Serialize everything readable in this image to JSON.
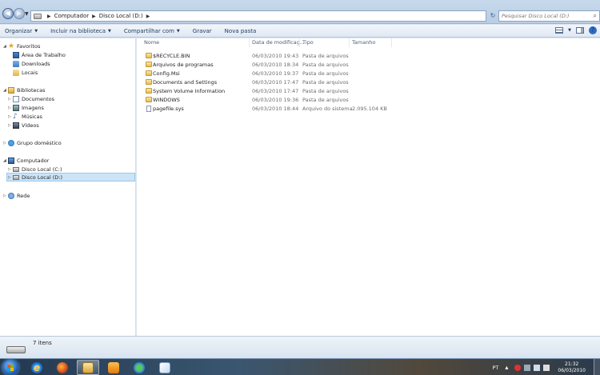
{
  "address": {
    "crumbs": [
      "Computador",
      "Disco Local (D:)"
    ],
    "search_placeholder": "Pesquisar Disco Local (D:)"
  },
  "toolbar": {
    "organize": "Organizar",
    "include_library": "Incluir na biblioteca",
    "share": "Compartilhar com",
    "burn": "Gravar",
    "new_folder": "Nova pasta"
  },
  "nav": {
    "favorites": "Favoritos",
    "desktop": "Área de Trabalho",
    "downloads": "Downloads",
    "locais": "Locais",
    "libraries": "Bibliotecas",
    "documents": "Documentos",
    "images": "Imagens",
    "music": "Músicas",
    "videos": "Vídeos",
    "homegroup": "Grupo doméstico",
    "computer": "Computador",
    "drive_c": "Disco Local (C:)",
    "drive_d": "Disco Local (D:)",
    "network": "Rede"
  },
  "columns": {
    "name": "Nome",
    "date": "Data de modificaç...",
    "type": "Tipo",
    "size": "Tamanho"
  },
  "files": [
    {
      "name": "$RECYCLE.BIN",
      "date": "06/03/2010 19:43",
      "type": "Pasta de arquivos",
      "size": "",
      "icon": "folder"
    },
    {
      "name": "Arquivos de programas",
      "date": "06/03/2010 18:34",
      "type": "Pasta de arquivos",
      "size": "",
      "icon": "folder"
    },
    {
      "name": "Config.Msi",
      "date": "06/03/2010 19:37",
      "type": "Pasta de arquivos",
      "size": "",
      "icon": "folder"
    },
    {
      "name": "Documents and Settings",
      "date": "06/03/2010 17:47",
      "type": "Pasta de arquivos",
      "size": "",
      "icon": "folder"
    },
    {
      "name": "System Volume Information",
      "date": "06/03/2010 17:47",
      "type": "Pasta de arquivos",
      "size": "",
      "icon": "folder"
    },
    {
      "name": "WINDOWS",
      "date": "06/03/2010 19:36",
      "type": "Pasta de arquivos",
      "size": "",
      "icon": "folder"
    },
    {
      "name": "pagefile.sys",
      "date": "06/03/2010 18:44",
      "type": "Arquivo do sistema",
      "size": "2.095.104 KB",
      "icon": "file"
    }
  ],
  "details": {
    "count": "7 itens"
  },
  "taskbar": {
    "lang": "PT",
    "time": "21:32",
    "date": "06/03/2010"
  },
  "colors": {
    "selection": "#cce4f7",
    "toolbar_text": "#1e395b"
  }
}
